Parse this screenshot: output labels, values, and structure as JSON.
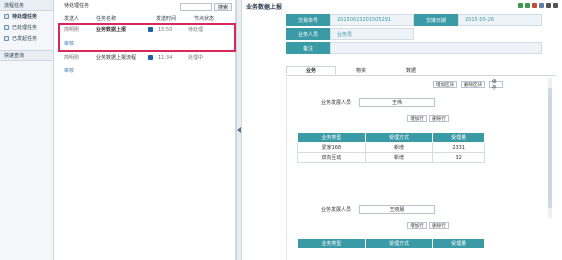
{
  "leftnav": {
    "header": "流程任务",
    "items": [
      {
        "label": "待处理任务",
        "active": true
      },
      {
        "label": "已处理任务",
        "active": false
      },
      {
        "label": "已发起任务",
        "active": false
      }
    ],
    "section": "快速查询"
  },
  "tasklist": {
    "title": "待处理任务",
    "search_label": "搜索",
    "columns": [
      "发送人",
      "任务名称",
      "发送时间",
      "节点状态"
    ],
    "rows": [
      {
        "sender": "简明刚",
        "name": "业务数据上报",
        "time": "15:50",
        "status": "待处理",
        "sub": "审核"
      },
      {
        "sender": "简明刚",
        "name": "业务数据上报流程",
        "time": "11:34",
        "status": "处理中",
        "sub": "审核"
      }
    ]
  },
  "detail": {
    "title": "业务数据上报",
    "info": {
      "r1": {
        "l1": "交易单号",
        "v1": "20150023201505291",
        "l2": "交接日期",
        "v2": "2015-05-26"
      },
      "r2": {
        "l1": "业务人员",
        "v1": "业务员"
      },
      "r3": {
        "l1": "备注"
      }
    },
    "tabs": [
      "业务",
      "物资",
      "数据"
    ],
    "buttons": {
      "add_block": "增加区块",
      "delete_block": "删除区块",
      "save": "保存"
    },
    "block1": {
      "label": "业务发展人员",
      "person": "王伟",
      "add_row": "增加行",
      "delete_row": "删除行",
      "headers": [
        "业务类型",
        "受理方式",
        "受理量"
      ],
      "rows": [
        {
          "type": "爱家168",
          "mode": "新增",
          "qty": "2331"
        },
        {
          "type": "双向互动",
          "mode": "新增",
          "qty": "32"
        }
      ]
    },
    "block2": {
      "label": "业务发展人员",
      "person": "王晓晨",
      "add_row": "增加行",
      "delete_row": "删除行",
      "headers": [
        "业务类型",
        "受理方式",
        "受理量"
      ]
    }
  }
}
